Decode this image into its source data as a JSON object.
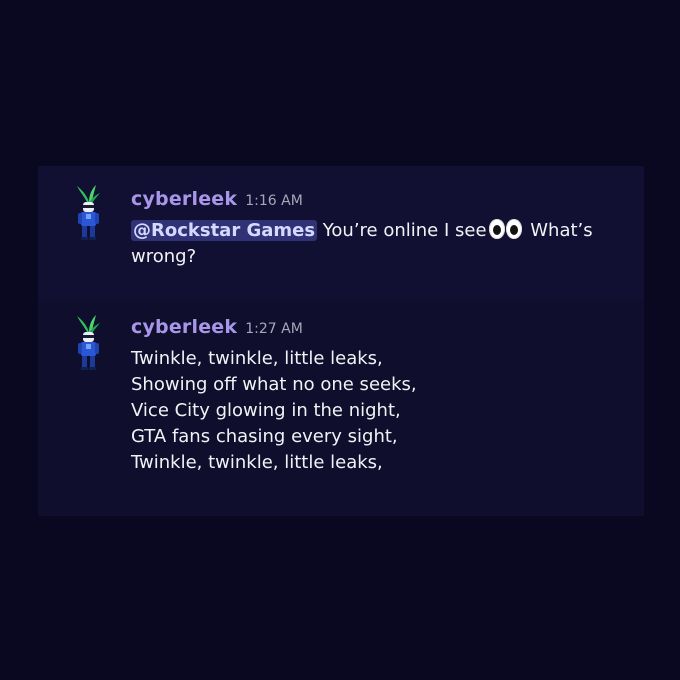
{
  "theme": {
    "background": "#0a0821",
    "message_bg": "#111033",
    "username_color": "#a896e8",
    "mention_bg": "#2f3275"
  },
  "messages": [
    {
      "username": "cyberleek",
      "time": "1:16 AM",
      "avatar_icon": "leek-avatar-icon",
      "mention": "@Rockstar Games",
      "text_before_emoji": " You’re online I see",
      "emoji": "eyes-emoji-icon",
      "text_after_emoji": " What’s wrong?"
    },
    {
      "username": "cyberleek",
      "time": "1:27 AM",
      "avatar_icon": "leek-avatar-icon",
      "lines": [
        "Twinkle, twinkle, little leaks,",
        "Showing off what no one seeks,",
        "Vice City glowing in the night,",
        "GTA fans chasing every sight,",
        "Twinkle, twinkle, little leaks,"
      ]
    }
  ]
}
